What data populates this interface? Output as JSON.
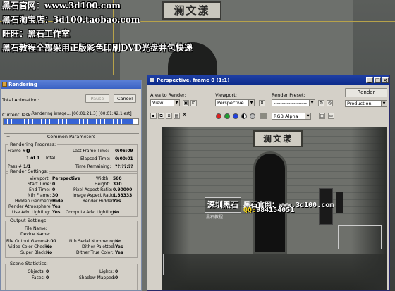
{
  "background": {
    "plaque_text": "澜文漾"
  },
  "overlay": {
    "line1": "黑石官网：www.3d100.com",
    "line2": "黑石淘宝店：3d100.taobao.com",
    "line3": "旺旺：黑石工作室",
    "line4": "黑石教程全部采用正版彩色印刷DVD光盘并包快递"
  },
  "rendering": {
    "title": "Rendering",
    "pause_label": "Pause",
    "cancel_label": "Cancel",
    "total_animation_label": "Total Animation:",
    "current_task_label": "Current Task:",
    "current_task_value": "Rendering image... [00:01:21.3] [00:01:42.1 est]",
    "progress": 0.96,
    "common_params_label": "Common Parameters",
    "progress_group": {
      "title": "Rendering Progress:",
      "frame_label": "Frame #",
      "frame_value": "0",
      "of_value": "1 of 1",
      "total_label": "Total",
      "pass_label": "Pass #",
      "pass_value": "1/1",
      "last_frame_label": "Last Frame Time:",
      "last_frame_value": "0:05:09",
      "elapsed_label": "Elapsed Time:",
      "elapsed_value": "0:00:01",
      "remaining_label": "Time Remaining:",
      "remaining_value": "??:??:??"
    },
    "render_settings": {
      "title": "Render Settings:",
      "viewport_label": "Viewport:",
      "viewport_value": "Perspective",
      "start_label": "Start Time:",
      "start_value": "0",
      "end_label": "End Time:",
      "end_value": "0",
      "nth_label": "Nth Frame:",
      "nth_value": "30",
      "hidden_label": "Hidden Geometry:",
      "hidden_value": "Hide",
      "atmos_label": "Render Atmosphere:",
      "atmos_value": "Yes",
      "useadv_label": "Use Adv. Lighting:",
      "useadv_value": "Yes",
      "width_label": "Width:",
      "width_value": "560",
      "height_label": "Height:",
      "height_value": "370",
      "pixel_aspect_label": "Pixel Aspect Ratio:",
      "pixel_aspect_value": "0.90000",
      "image_aspect_label": "Image Aspect Ratio:",
      "image_aspect_value": "1.33333",
      "render_hidden_label": "Render Hidden:",
      "render_hidden_value": "Yes",
      "compute_adv_label": "Compute Adv. Lighting:",
      "compute_adv_value": "No"
    },
    "output_settings": {
      "title": "Output Settings:",
      "file_name_label": "File Name:",
      "device_name_label": "Device Name:",
      "gamma_label": "File Output Gamma:",
      "gamma_value": "1.00",
      "video_check_label": "Video Color Check:",
      "video_check_value": "No",
      "super_black_label": "Super Black:",
      "super_black_value": "No",
      "nth_serial_label": "Nth Serial Numbering:",
      "nth_serial_value": "No",
      "dither_pal_label": "Dither Paletted:",
      "dither_pal_value": "Yes",
      "dither_true_label": "Dither True Color:",
      "dither_true_value": "Yes"
    },
    "scene_stats": {
      "title": "Scene Statistics:",
      "objects_label": "Objects:",
      "objects_value": "0",
      "faces_label": "Faces:",
      "faces_value": "0",
      "lights_label": "Lights:",
      "lights_value": "0",
      "shadow_label": "Shadow Mapped:",
      "shadow_value": "0"
    }
  },
  "perspective": {
    "title": "Perspective, frame 0 (1:1)",
    "area_label": "Area to Render:",
    "area_value": "View",
    "viewport_label": "Viewport:",
    "viewport_value": "Perspective",
    "preset_label": "Render Preset:",
    "preset_value": "--------------------",
    "render_label": "Render",
    "production_value": "Production",
    "channel_value": "RGB Alpha"
  },
  "watermark": {
    "site": "黑石官网：www.3d100.com",
    "qq_label": "QQ:",
    "qq_value": "984154051",
    "logo_text": "深圳黑石",
    "sub_text": "黑石教程"
  }
}
